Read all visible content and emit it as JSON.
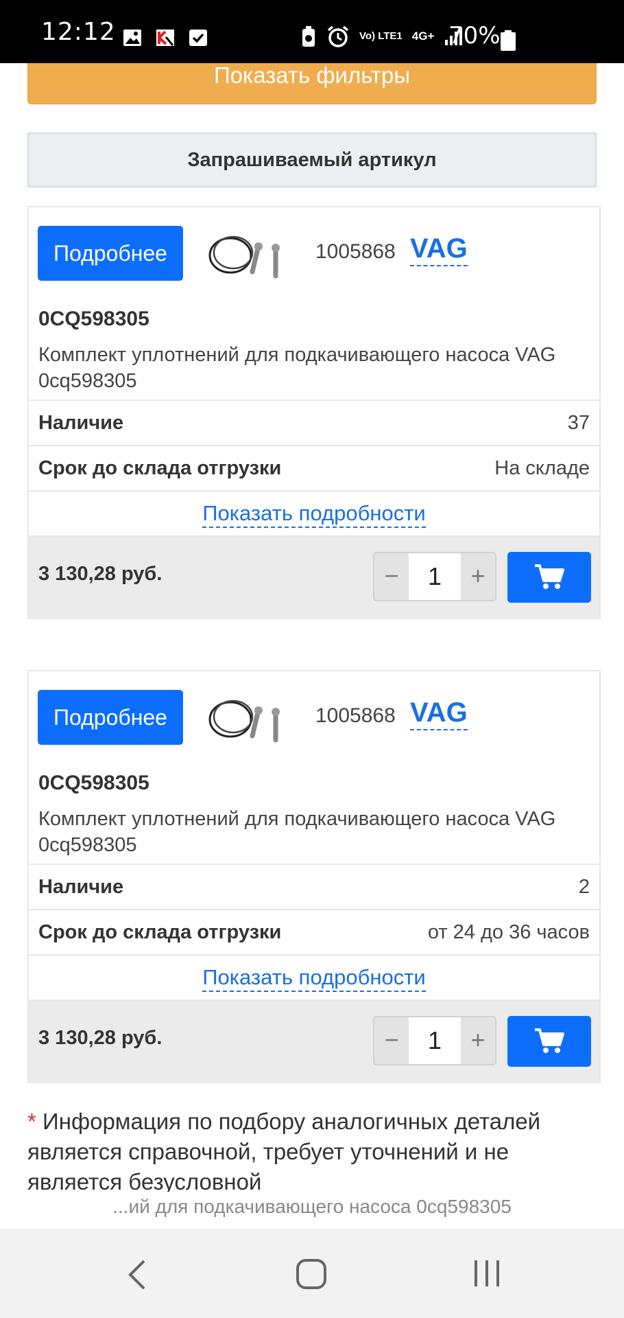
{
  "status_bar": {
    "time": "12:12",
    "network_label": "Vo) LTE1",
    "network_gen": "4G+",
    "battery": "70%",
    "icons": [
      "image-icon",
      "kaspersky-icon",
      "check-icon",
      "battery-saver-icon",
      "alarm-icon",
      "signal-icon",
      "battery-icon"
    ]
  },
  "filters_button": {
    "label": "Показать фильтры"
  },
  "section_header": {
    "title": "Запрашиваемый артикул"
  },
  "products": [
    {
      "more_label": "Подробнее",
      "part_number": "1005868",
      "brand": "VAG",
      "article": "0CQ598305",
      "description": "Комплект уплотнений для подкачивающего насоса VAG 0cq598305",
      "availability_label": "Наличие",
      "availability_value": "37",
      "delivery_label": "Срок до склада отгрузки",
      "delivery_value": "На складе",
      "details_label": "Показать подробности",
      "price": "3 130,28 руб.",
      "minus": "−",
      "qty": "1",
      "plus": "+"
    },
    {
      "more_label": "Подробнее",
      "part_number": "1005868",
      "brand": "VAG",
      "article": "0CQ598305",
      "description": "Комплект уплотнений для подкачивающего насоса VAG 0cq598305",
      "availability_label": "Наличие",
      "availability_value": "2",
      "delivery_label": "Срок до склада отгрузки",
      "delivery_value": "от 24 до 36 часов",
      "details_label": "Показать подробности",
      "price": "3 130,28 руб.",
      "minus": "−",
      "qty": "1",
      "plus": "+"
    }
  ],
  "note": {
    "asterisk": "*",
    "text": " Информация по подбору аналогичных деталей является справочной, требует уточнений и не является безусловной"
  },
  "page_title_overlay": "...ий для подкачивающего насоса 0cq598305",
  "colors": {
    "primary": "#0d6efd",
    "warning": "#f0ad4e",
    "link": "#1a6fe0"
  }
}
